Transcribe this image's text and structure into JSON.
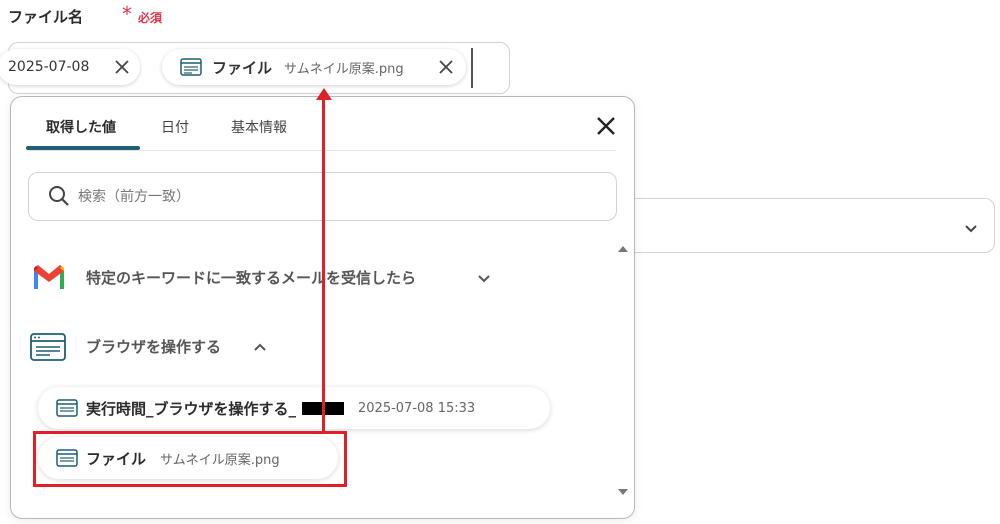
{
  "field": {
    "label": "ファイル名",
    "required_mark": "*",
    "required_text": "必須"
  },
  "token_input": {
    "chips": [
      {
        "label": "2025-07-08"
      },
      {
        "label": "ファイル",
        "sublabel": "サムネイル原案.png"
      }
    ]
  },
  "popup": {
    "tabs": [
      {
        "label": "取得した値",
        "active": true
      },
      {
        "label": "日付",
        "active": false
      },
      {
        "label": "基本情報",
        "active": false
      }
    ],
    "search": {
      "placeholder": "検索（前方一致）"
    },
    "groups": [
      {
        "title": "特定のキーワードに一致するメールを受信したら",
        "icon": "gmail-icon",
        "expanded": false
      },
      {
        "title": "ブラウザを操作する",
        "icon": "browser-window-icon",
        "expanded": true
      }
    ],
    "items": [
      {
        "label": "実行時間_ブラウザを操作する_",
        "value": "2025-07-08 15:33"
      },
      {
        "label": "ファイル",
        "value": "サムネイル原案.png"
      }
    ]
  },
  "colors": {
    "required": "#e0354b",
    "tab_accent": "#1f5f73",
    "annotation_red": "#e02027"
  }
}
